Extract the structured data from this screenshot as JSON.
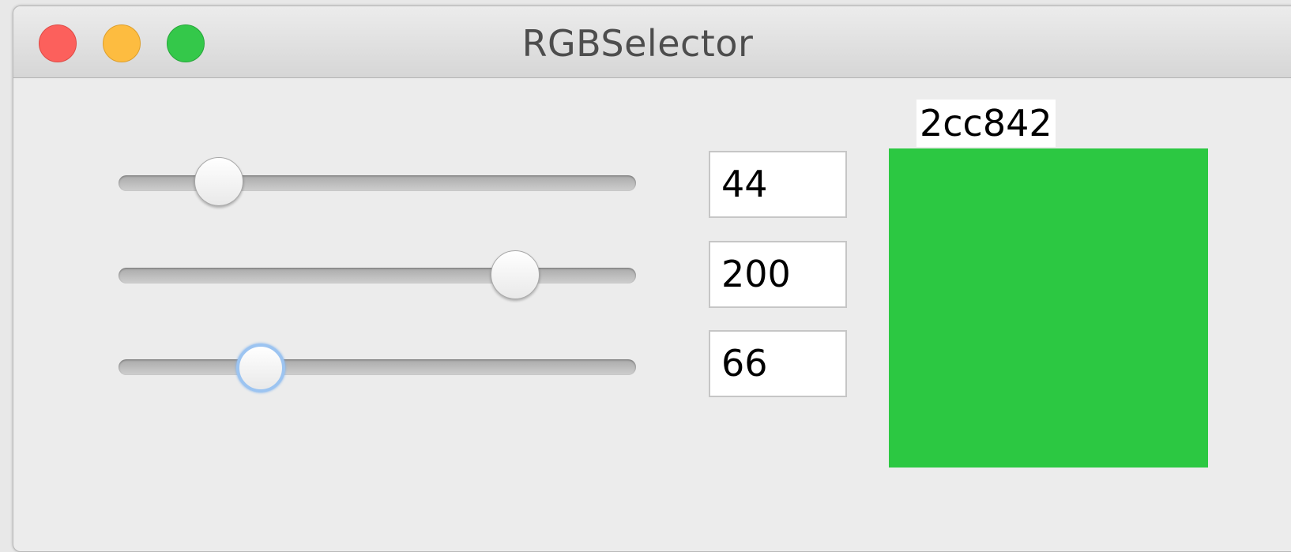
{
  "window": {
    "title": "RGBSelector"
  },
  "sliders": [
    {
      "channel": "red",
      "value": 44,
      "min": 0,
      "max": 255,
      "focused": false,
      "value_text": "44"
    },
    {
      "channel": "green",
      "value": 200,
      "min": 0,
      "max": 255,
      "focused": false,
      "value_text": "200"
    },
    {
      "channel": "blue",
      "value": 66,
      "min": 0,
      "max": 255,
      "focused": true,
      "value_text": "66"
    }
  ],
  "preview": {
    "hex_label": "2cc842",
    "color": "#2cc842"
  },
  "colors": {
    "close": "#fc605c",
    "minimize": "#fdbc40",
    "maximize": "#34c84a"
  }
}
